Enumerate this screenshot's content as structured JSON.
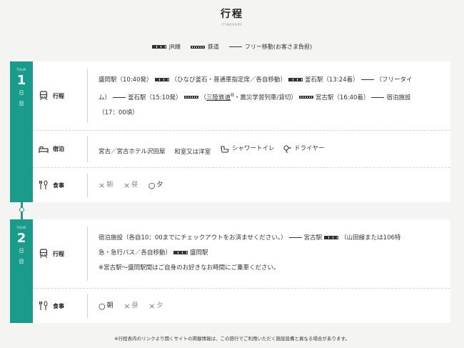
{
  "header": {
    "title": "行程",
    "subtitle": "ITINERARY"
  },
  "legend": {
    "jr": "JR線",
    "rail": "鉄道",
    "free": "フリー移動(お客さま負担)"
  },
  "days": [
    {
      "tour": "TOUR",
      "num": "1",
      "nichi": "日",
      "me": "目",
      "itinerary_label": "行程",
      "itinerary": {
        "p1": "盛岡駅（10:40発）",
        "p2": "（ひなび釜石・普通車指定席／各自移動）",
        "p3": "釜石駅（13:24着）",
        "p4": "（フリータイ",
        "p5": "ム）",
        "p6": "釜石駅（15:10発）",
        "p7": "（",
        "p8": "三陸鉄道",
        "p9": "・震災学習列車/貸切）",
        "p10": "宮古駅（16:40着）",
        "p11": "宿泊施設",
        "p12": "（17：00頃）"
      },
      "lodging_label": "宿泊",
      "lodging": {
        "hotel": "宮古／宮古ホテル沢田屋",
        "room": "和室又は洋室",
        "shower": "シャワートイレ",
        "dryer": "ドライヤー"
      },
      "meal_label": "食事",
      "meals": [
        {
          "mark": "×",
          "name": "朝"
        },
        {
          "mark": "×",
          "name": "昼"
        },
        {
          "mark": "○",
          "name": "夕"
        }
      ]
    },
    {
      "tour": "TOUR",
      "num": "2",
      "nichi": "日",
      "me": "目",
      "itinerary_label": "行程",
      "itinerary": {
        "p1": "宿泊施設（各自10：00までにチェックアウトをお済ませください。）",
        "p2": "宮古駅",
        "p3": "（山田線または106特",
        "p4": "急・急行バス／各自移動）",
        "p5": "盛岡駅",
        "p6": "※宮古駅〜盛岡駅間はご自身のお好きなお時間にご乗車ください。"
      },
      "meal_label": "食事",
      "meals": [
        {
          "mark": "○",
          "name": "朝"
        },
        {
          "mark": "×",
          "name": "昼"
        },
        {
          "mark": "×",
          "name": "夕"
        }
      ]
    }
  ],
  "footnote": "※行程表内のリンクより開くサイトの掲載情報は、この旅行でご利用いただく施設設備と異なる場合があります。",
  "colors": {
    "accent": "#1a9c8c"
  }
}
